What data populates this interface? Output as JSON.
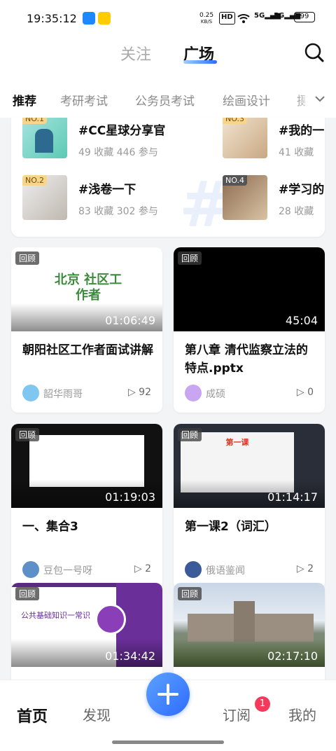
{
  "status_bar": {
    "time": "19:35:12",
    "net_speed": "0.25",
    "net_unit": "KB/S",
    "hd": "HD",
    "sig1": "5G",
    "sig2": "5G",
    "battery": "99"
  },
  "header": {
    "follow_label": "关注",
    "square_label": "广场"
  },
  "category_tabs": [
    "推荐",
    "考研考试",
    "公务员考试",
    "绘画设计",
    "摄"
  ],
  "topics": [
    {
      "rank": "NO.1",
      "title": "#CC星球分享官",
      "stats": "49 收藏  446 参与"
    },
    {
      "rank": "NO.3",
      "title": "#我的一",
      "stats": "41 收藏"
    },
    {
      "rank": "NO.2",
      "title": "#浅卷一下",
      "stats": "83 收藏  302 参与"
    },
    {
      "rank": "NO.4",
      "title": "#学习的",
      "stats": "28 收藏"
    }
  ],
  "cards": [
    {
      "tag": "回顾",
      "duration": "01:06:49",
      "title": "朝阳社区工作者面试讲解",
      "author": "韶华雨哥",
      "plays": "92",
      "thumb_text": "北京 社区工作者"
    },
    {
      "tag": "回顾",
      "duration": "45:04",
      "title": "第八章 清代监察立法的特点.pptx",
      "author": "成硕",
      "plays": "0"
    },
    {
      "tag": "回顾",
      "duration": "01:19:03",
      "title": "一、集合3",
      "author": "豆包一号呀",
      "plays": "2"
    },
    {
      "tag": "回顾",
      "duration": "01:14:17",
      "title": "第一课2（词汇）",
      "author": "俄语鉴闻",
      "plays": "2",
      "thumb_text": "第一课"
    },
    {
      "tag": "回顾",
      "duration": "01:34:42",
      "title": "",
      "author": "",
      "plays": "",
      "thumb_text": "公共基础知识一常识"
    },
    {
      "tag": "回顾",
      "duration": "02:17:10",
      "title": "",
      "author": "",
      "plays": ""
    }
  ],
  "bottom_nav": {
    "home": "首页",
    "discover": "发现",
    "subscribe": "订阅",
    "mine": "我的",
    "subscribe_badge": "1"
  },
  "colors": {
    "accent": "#2f6bff",
    "badge": "#f33a5c"
  }
}
